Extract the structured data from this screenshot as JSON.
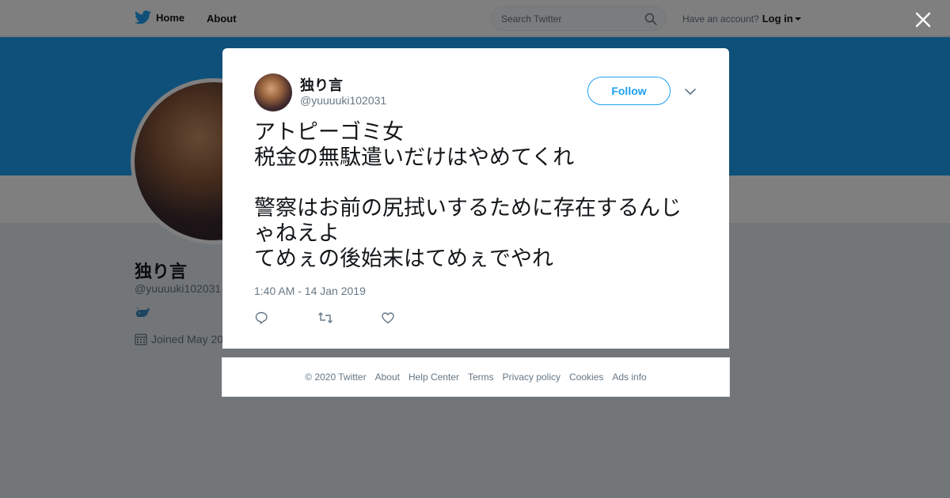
{
  "topbar": {
    "home_label": "Home",
    "about_label": "About",
    "search_placeholder": "Search Twitter",
    "account_prompt": "Have an account?",
    "login_label": "Log in"
  },
  "profile": {
    "name": "独り言",
    "handle": "@yuuuuki102031",
    "joined": "Joined May 20"
  },
  "tweet": {
    "name": "独り言",
    "handle": "@yuuuuki102031",
    "follow_label": "Follow",
    "text": "アトピーゴミ女\n税金の無駄遣いだけはやめてくれ\n\n警察はお前の尻拭いするために存在するんじゃねえよ\nてめぇの後始末はてめぇでやれ",
    "timestamp": "1:40 AM - 14 Jan 2019"
  },
  "footer": {
    "links": [
      "© 2020 Twitter",
      "About",
      "Help Center",
      "Terms",
      "Privacy policy",
      "Cookies",
      "Ads info"
    ]
  },
  "colors": {
    "brand": "#1da1f2",
    "overlay": "rgba(0,0,0,0.5)",
    "text_secondary": "#657786"
  },
  "icons": [
    "twitter-bird-icon",
    "search-icon",
    "close-icon",
    "chevron-down-icon",
    "reply-icon",
    "retweet-icon",
    "like-icon",
    "whale-icon",
    "calendar-icon"
  ]
}
